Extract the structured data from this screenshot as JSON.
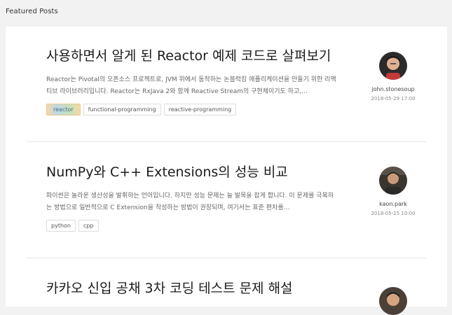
{
  "section": {
    "title": "Featured Posts"
  },
  "posts": [
    {
      "title": "사용하면서 알게 된 Reactor 예제 코드로 살펴보기",
      "excerpt": "Reactor는 Pivotal의 오픈소스 프로젝트로, JVM 위에서 동작하는 논블럭킹 애플리케이션을 만들기 위한 리액티브 라이브러리입니다. Reactor는 RxJava 2와 함께 Reactive Stream의 구현체이기도 하고,…",
      "tags": [
        "reactor",
        "functional-programming",
        "reactive-programming"
      ],
      "author": "john.stonesoup",
      "date": "2018-05-29 17:00",
      "avatar_icon": "person-avatar-icon"
    },
    {
      "title": "NumPy와 C++ Extensions의 성능 비교",
      "excerpt": "파이썬은 놀라운 생산성을 발휘하는 언어입니다. 하지만 성능 문제는 늘 발목을 잡게 합니다. 이 문제를 극복하는 방법으로 일반적으로 C Extension을 작성하는 방법이 권장되며, 여기서는 표준 편차를…",
      "tags": [
        "python",
        "cpp"
      ],
      "author": "kaon.park",
      "date": "2018-05-15 10:00",
      "avatar_icon": "person-avatar-icon"
    },
    {
      "title": "카카오 신입 공채 3차 코딩 테스트 문제 해설",
      "avatar_icon": "person-avatar-icon"
    }
  ],
  "colors": {
    "page_bg": "#f2f2f2",
    "card_bg": "#ffffff",
    "tag_border": "#dcdcdc",
    "highlight_tag_text": "#4a6c86"
  }
}
